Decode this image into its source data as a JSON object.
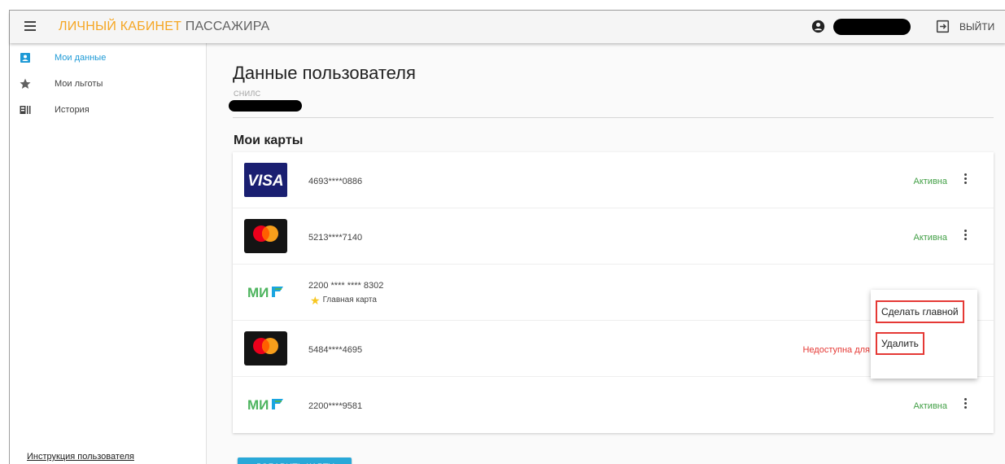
{
  "header": {
    "title_accent": "ЛИЧНЫЙ КАБИНЕТ",
    "title_rest": " ПАССАЖИРА",
    "logout_label": "ВЫЙТИ",
    "accent_color": "#f5a623"
  },
  "sidebar": {
    "items": [
      {
        "label": "Мои данные",
        "icon": "user-badge-icon",
        "active": true
      },
      {
        "label": "Мои льготы",
        "icon": "star-icon",
        "active": false
      },
      {
        "label": "История",
        "icon": "history-icon",
        "active": false
      }
    ],
    "manual_link": "Инструкция пользователя",
    "active_color": "#1e9ad6"
  },
  "main": {
    "page_title": "Данные пользователя",
    "snils_label": "СНИЛС",
    "cards_title": "Мои карты",
    "cards": [
      {
        "brand": "visa-logo",
        "number": "4693****0886",
        "status": "Активна"
      },
      {
        "brand": "mastercard-logo",
        "number": "5213****7140",
        "status": "Активна"
      },
      {
        "brand": "mir-logo",
        "number": "2200 **** **** 8302",
        "main_label": "Главная карта",
        "status": ""
      },
      {
        "brand": "mastercard-logo",
        "number": "5484****4695",
        "status": "Недоступна для"
      },
      {
        "brand": "mir-logo",
        "number": "2200****9581",
        "status": "Активна"
      }
    ],
    "context_menu": {
      "make_main": "Сделать главной",
      "delete": "Удалить"
    },
    "add_button": "ДОБАВИТЬ КАРТУ",
    "status_ok_color": "#43a047",
    "status_bad_color": "#e53935"
  }
}
